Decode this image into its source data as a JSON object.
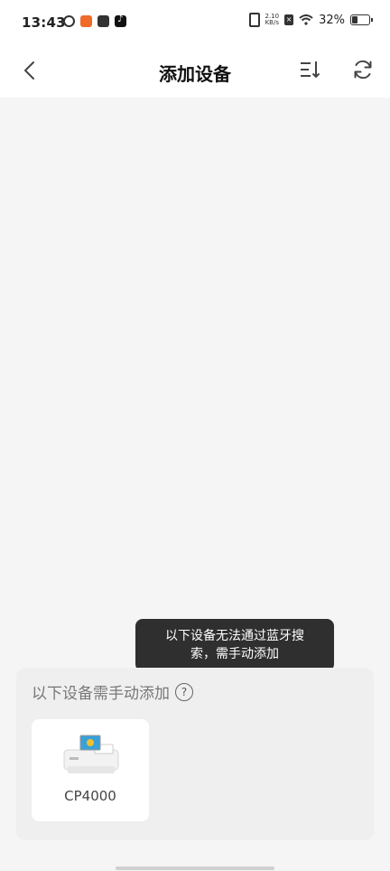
{
  "status_bar": {
    "time": "13:43",
    "net_speed_value": "2.10",
    "net_speed_unit": "KB/s",
    "battery": "32%"
  },
  "header": {
    "title": "添加设备"
  },
  "manual_section": {
    "title": "以下设备需手动添加",
    "help_symbol": "?"
  },
  "tooltip": {
    "line1": "以下设备无法通过蓝牙搜",
    "line2": "索，需手动添加"
  },
  "devices": [
    {
      "label": "CP4000"
    }
  ],
  "colors": {
    "tooltip_bg": "#2f2f2f",
    "panel_bg": "#efefef",
    "app_orange": "#f06a2a"
  }
}
